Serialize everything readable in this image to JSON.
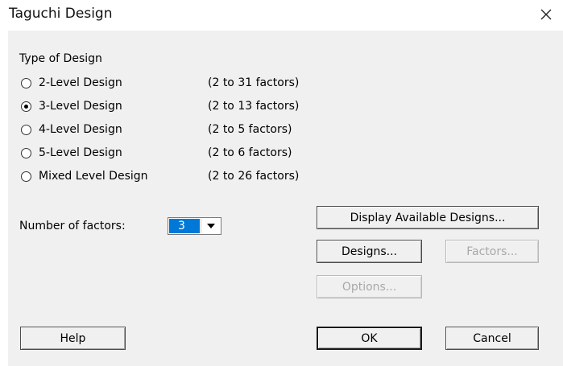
{
  "window": {
    "title": "Taguchi Design",
    "close_glyph": "✕"
  },
  "type_of_design": {
    "label": "Type of Design",
    "options": [
      {
        "label": "2-Level Design",
        "range": "(2 to 31 factors)",
        "selected": false
      },
      {
        "label": "3-Level Design",
        "range": "(2 to 13 factors)",
        "selected": true
      },
      {
        "label": "4-Level Design",
        "range": "(2 to 5 factors)",
        "selected": false
      },
      {
        "label": "5-Level Design",
        "range": "(2 to 6 factors)",
        "selected": false
      },
      {
        "label": "Mixed Level Design",
        "range": "(2 to 26 factors)",
        "selected": false
      }
    ]
  },
  "number_of_factors": {
    "label": "Number of factors:",
    "value": "3"
  },
  "buttons": {
    "display_available": "Display Available Designs...",
    "designs": "Designs...",
    "factors": "Factors...",
    "options": "Options...",
    "help": "Help",
    "ok": "OK",
    "cancel": "Cancel"
  },
  "colors": {
    "dialog_bg": "#f0f0f0",
    "selection": "#0078d7",
    "disabled_text": "#a8a8a8"
  }
}
